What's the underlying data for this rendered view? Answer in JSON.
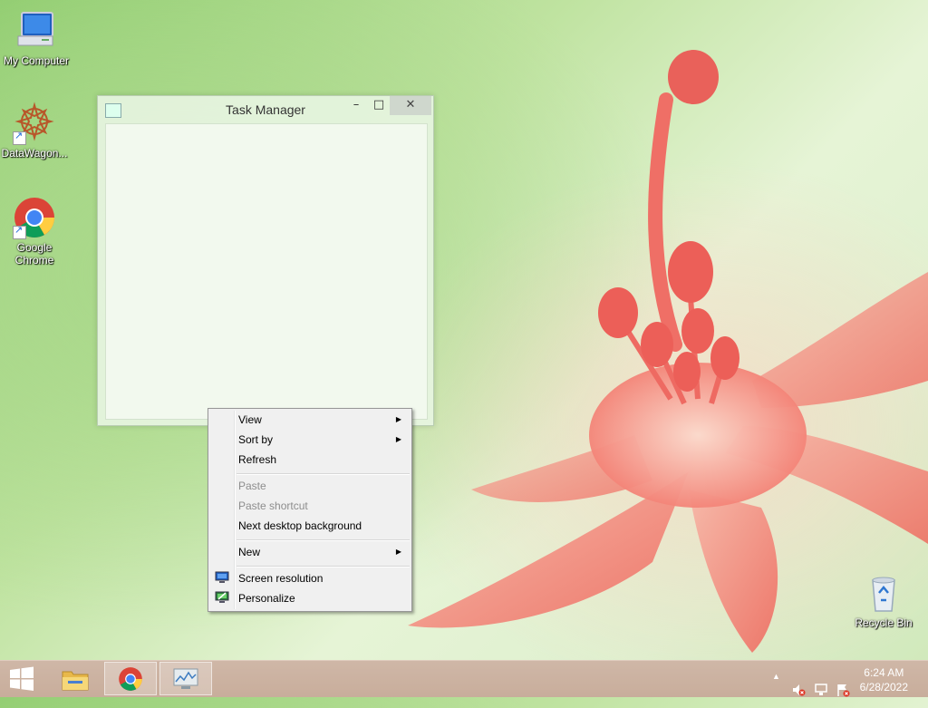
{
  "desktop": {
    "icons": [
      {
        "label": "My Computer",
        "icon": "computer-icon"
      },
      {
        "label": "DataWagon...",
        "icon": "datawagon-icon"
      },
      {
        "label": "Google Chrome",
        "icon": "chrome-icon"
      },
      {
        "label": "Recycle Bin",
        "icon": "recycle-bin-icon"
      }
    ]
  },
  "window": {
    "title": "Task Manager",
    "minimize": "–",
    "maximize": "□",
    "close": "✕"
  },
  "context_menu": {
    "items": [
      {
        "label": "View",
        "submenu": true,
        "enabled": true
      },
      {
        "label": "Sort by",
        "submenu": true,
        "enabled": true
      },
      {
        "label": "Refresh",
        "submenu": false,
        "enabled": true
      },
      {
        "label": "Paste",
        "submenu": false,
        "enabled": false
      },
      {
        "label": "Paste shortcut",
        "submenu": false,
        "enabled": false
      },
      {
        "label": "Next desktop background",
        "submenu": false,
        "enabled": true
      },
      {
        "label": "New",
        "submenu": true,
        "enabled": true
      },
      {
        "label": "Screen resolution",
        "submenu": false,
        "enabled": true,
        "icon": "display-icon"
      },
      {
        "label": "Personalize",
        "submenu": false,
        "enabled": true,
        "icon": "personalize-icon"
      }
    ],
    "submenu_arrow": "▶"
  },
  "taskbar": {
    "buttons": [
      {
        "name": "start",
        "icon": "windows-logo-icon"
      },
      {
        "name": "file-explorer",
        "icon": "folder-icon"
      },
      {
        "name": "chrome",
        "icon": "chrome-icon"
      },
      {
        "name": "task-manager",
        "icon": "task-manager-icon"
      }
    ],
    "tray": {
      "show_hidden": "▲",
      "icons": [
        "volume-muted-icon",
        "network-icon",
        "action-center-icon"
      ]
    },
    "clock": {
      "time": "6:24 AM",
      "date": "6/28/2022"
    }
  },
  "colors": {
    "taskbar": "#c8ad9b",
    "menu_bg": "#f0f0f0",
    "flower": "#f07a6e"
  }
}
